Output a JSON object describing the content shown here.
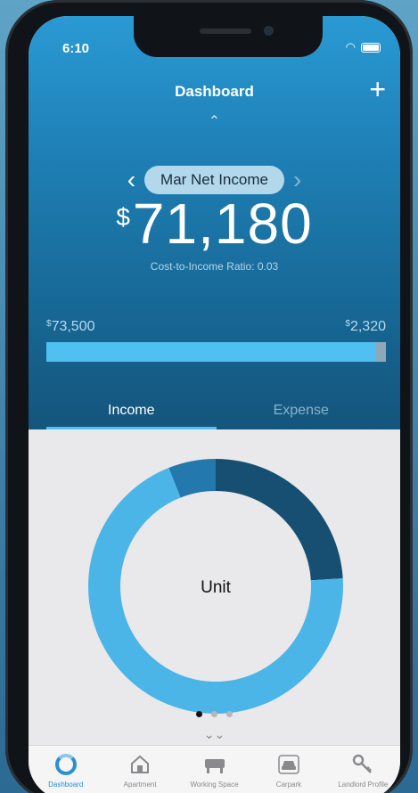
{
  "status_bar": {
    "time": "6:10"
  },
  "header": {
    "title": "Dashboard",
    "add_label": "+",
    "collapse_label": "⌃"
  },
  "metric": {
    "prev_label": "‹",
    "next_label": "›",
    "name": "Mar Net Income",
    "currency": "$",
    "amount": "71,180",
    "ratio_text": "Cost-to-Income Ratio: 0.03"
  },
  "income_bar": {
    "left_currency": "$",
    "left_value": "73,500",
    "right_currency": "$",
    "right_value": "2,320",
    "income_fraction": 0.97
  },
  "tabs": [
    {
      "label": "Income",
      "active": true
    },
    {
      "label": "Expense",
      "active": false
    }
  ],
  "chart_data": {
    "type": "pie",
    "center_label": "Unit",
    "slices": [
      {
        "value": 24,
        "color": "#174f73"
      },
      {
        "value": 70,
        "color": "#4bb5e8"
      },
      {
        "value": 6,
        "color": "#2378ad"
      }
    ]
  },
  "pager": {
    "count": 3,
    "active": 0,
    "expand_label": "⌄⌄"
  },
  "tabbar": [
    {
      "label": "Dashboard",
      "icon": "ring-chart-icon",
      "active": true
    },
    {
      "label": "Apartment",
      "icon": "house-icon",
      "active": false
    },
    {
      "label": "Working Space",
      "icon": "desk-icon",
      "active": false
    },
    {
      "label": "Carpark",
      "icon": "car-icon",
      "active": false
    },
    {
      "label": "Landlord Profile",
      "icon": "key-icon",
      "active": false
    }
  ],
  "colors": {
    "accent": "#4fc0ef",
    "hero_top": "#2a9ad4",
    "hero_bottom": "#14557c"
  }
}
